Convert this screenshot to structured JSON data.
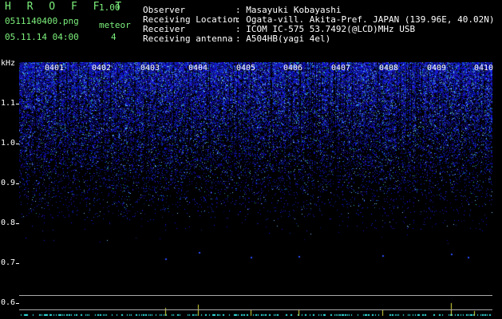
{
  "header": {
    "app_name": "H R O F F T",
    "version": "1.00",
    "filename": "0511140400.png",
    "datetime": "05.11.14 04:00",
    "meteor_label": "meteor",
    "meteor_count": "4",
    "observer_key": "Observer",
    "observer_val": ": Masayuki Kobayashi",
    "location_key": "Receiving Location",
    "location_val": ": Ogata-vill. Akita-Pref. JAPAN (139.96E, 40.02N)",
    "receiver_key": "Receiver",
    "receiver_val": ": ICOM IC-575 53.7492(@LCD)MHz USB",
    "antenna_key": "Receiving antenna",
    "antenna_val": ": A504HB(yagi 4el)"
  },
  "axis": {
    "unit": "kHz",
    "y_labels": [
      "1.1",
      "1.0",
      "0.9",
      "0.8",
      "0.7",
      "0.6"
    ],
    "time_labels": [
      "0401",
      "0402",
      "0403",
      "0404",
      "0405",
      "0406",
      "0407",
      "0408",
      "0409",
      "0410"
    ]
  },
  "colors": {
    "accent": "#7cf07c",
    "signal": "#1a3cff",
    "baseline": "#33e0e0"
  }
}
